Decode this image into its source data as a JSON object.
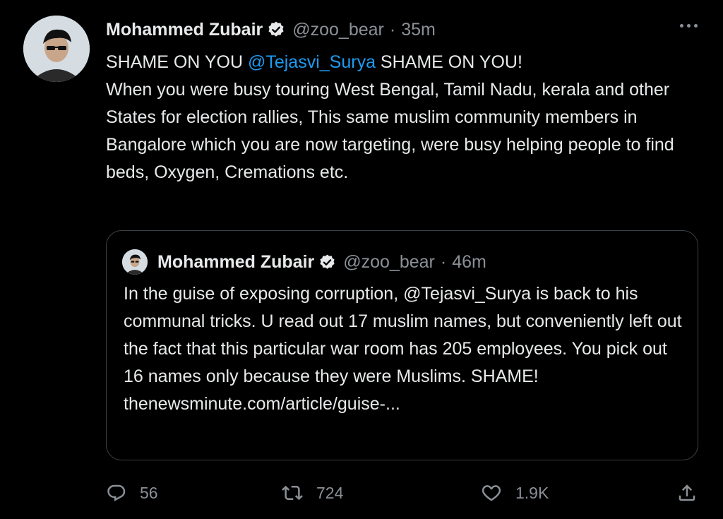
{
  "tweet": {
    "author_name": "Mohammed Zubair",
    "handle": "@zoo_bear",
    "separator": "·",
    "time": "35m",
    "text_before_mention": "SHAME ON YOU ",
    "mention": "@Tejasvi_Surya",
    "text_after_mention": " SHAME ON YOU!",
    "paragraph": "When you were busy touring West Bengal, Tamil Nadu, kerala and other States for election rallies, This same muslim community members in Bangalore which you are now targeting, were busy helping people to find beds, Oxygen, Cremations etc."
  },
  "quoted": {
    "author_name": "Mohammed Zubair",
    "handle": "@zoo_bear",
    "separator": "·",
    "time": "46m",
    "text": "In the guise of exposing corruption, @Tejasvi_Surya is back to his communal tricks. U read out 17 muslim names, but conveniently left out the fact that this particular war room has 205 employees. You pick out 16 names only because they were Muslims. SHAME!",
    "link": "thenewsminute.com/article/guise-..."
  },
  "actions": {
    "replies": "56",
    "retweets": "724",
    "likes": "1.9K"
  },
  "colors": {
    "background": "#000000",
    "text": "#e7e9ea",
    "secondary": "#8b9096",
    "mention": "#1d9bf0",
    "border": "#3b4045"
  },
  "icons": [
    "verified-badge-icon",
    "more-options-icon",
    "reply-icon",
    "retweet-icon",
    "like-icon",
    "share-icon"
  ]
}
